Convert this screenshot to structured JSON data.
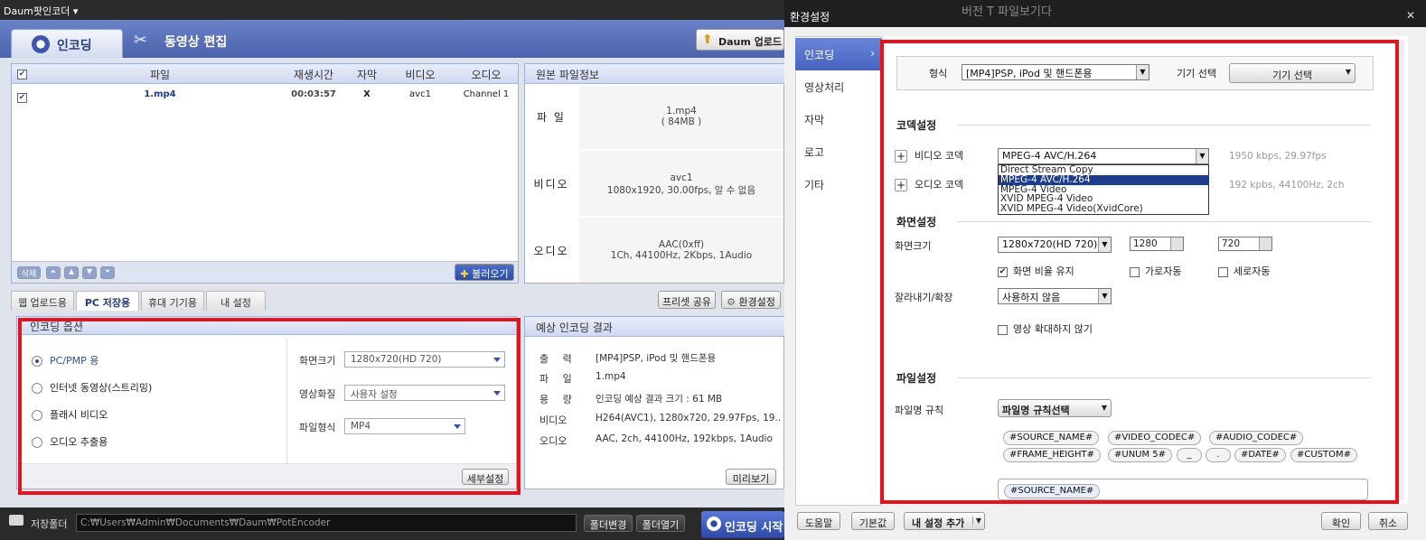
{
  "left": {
    "title": "Daum팟인코더 ▾",
    "tabs": {
      "encoding": "인코딩",
      "edit": "동영상 편집"
    },
    "upload": "Daum 업로드",
    "file_cols": [
      "파일",
      "재생시간",
      "자막",
      "비디오",
      "오디오"
    ],
    "file_row": {
      "name": "1.mp4",
      "duration": "00:03:57",
      "sub": "X",
      "video": "avc1",
      "audio": "Channel 1"
    },
    "list_btns": {
      "delete": "삭제",
      "load": "불러오기"
    },
    "src_info": {
      "title": "원본 파일정보",
      "file_lbl": "파 일",
      "file_val1": "1.mp4",
      "file_val2": "( 84MB )",
      "video_lbl": "비디오",
      "video_val1": "avc1",
      "video_val2": "1080x1920, 30.00fps, 알 수 없음",
      "audio_lbl": "오디오",
      "audio_val1": "AAC(0xff)",
      "audio_val2": "1Ch, 44100Hz, 2Kbps, 1Audio"
    },
    "subtabs": [
      "웹 업로드용",
      "PC 저장용",
      "휴대 기기용",
      "내 설정"
    ],
    "preset_share": "프리셋 공유",
    "env": "환경설정",
    "options": {
      "title": "인코딩 옵션",
      "radios": [
        "PC/PMP 용",
        "인터넷 동영상(스트리밍)",
        "플래시 비디오",
        "오디오 추출용"
      ],
      "res_lbl": "화면크기",
      "res_val": "1280x720(HD 720)",
      "quality_lbl": "영상화질",
      "quality_val": "사용자 설정",
      "format_lbl": "파일형식",
      "format_val": "MP4",
      "detail": "세부설정"
    },
    "result": {
      "title": "예상 인코딩 결과",
      "out_lbl": "출 력",
      "out_val": "[MP4]PSP, iPod 및 핸드폰용",
      "file_lbl": "파 일",
      "file_val": "1.mp4",
      "size_lbl": "용 량",
      "size_val": "인코딩 예상 결과 크기 : 61 MB",
      "video_lbl": "비디오",
      "video_val": "H264(AVC1), 1280x720, 29.97Fps, 19...",
      "audio_lbl": "오디오",
      "audio_val": "AAC, 2ch, 44100Hz, 192kbps, 1Audio",
      "preview": "미리보기"
    },
    "bottom": {
      "folder_lbl": "저장폴더",
      "path": "C:₩Users₩Admin₩Documents₩Daum₩PotEncoder",
      "change": "폴더변경",
      "open": "폴더열기",
      "start": "인코딩 시작"
    }
  },
  "right": {
    "title": "환경설정",
    "nav": [
      "인코딩",
      "영상처리",
      "자막",
      "로고",
      "기타"
    ],
    "format_lbl": "형식",
    "format_val": "[MP4]PSP, iPod 및 핸드폰용",
    "device_lbl": "기기 선택",
    "device_btn": "기기 선택",
    "codec_sec": "코덱설정",
    "video_codec_lbl": "비디오 코덱",
    "video_codec_val": "MPEG-4 AVC/H.264",
    "video_codec_info": "1950 kbps, 29.97fps",
    "codec_options": [
      "Direct Stream Copy",
      "MPEG-4 AVC/H.264",
      "MPEG-4 Video",
      "XVID MPEG-4 Video",
      "XVID MPEG-4 Video(XvidCore)"
    ],
    "audio_codec_lbl": "오디오 코덱",
    "audio_codec_info": "192 kpbs, 44100Hz, 2ch",
    "screen_sec": "화면설정",
    "size_lbl": "화면크기",
    "size_val": "1280x720(HD 720)",
    "w": "1280",
    "h": "720",
    "keep_ratio": "화면 비율 유지",
    "auto_w": "가로자동",
    "auto_h": "세로자동",
    "crop_lbl": "잘라내기/확장",
    "crop_val": "사용하지 않음",
    "no_zoom": "영상 확대하지 않기",
    "file_sec": "파일설정",
    "rule_lbl": "파일명 규칙",
    "rule_btn": "파일명 규칙선택",
    "tags1": [
      "#SOURCE_NAME#",
      "#VIDEO_CODEC#",
      "#AUDIO_CODEC#"
    ],
    "tags2": [
      "#FRAME_HEIGHT#",
      "#UNUM 5#",
      "_",
      ".",
      "#DATE#",
      "#CUSTOM#"
    ],
    "pattern": "#SOURCE_NAME#",
    "help": "도움말",
    "default": "기본값",
    "add_mine": "내 설정 추가",
    "ok": "확인",
    "cancel": "취소",
    "bg_text": "버전 T 파일보기다"
  }
}
